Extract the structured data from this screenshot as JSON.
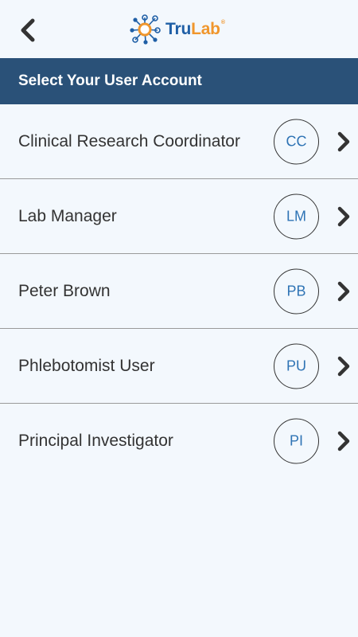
{
  "app": {
    "logo": {
      "text_part1": "Tru",
      "text_part2": "Lab",
      "registered_mark": "®"
    },
    "back_icon": "chevron-left-icon"
  },
  "header": {
    "title": "Select Your User Account"
  },
  "accounts": [
    {
      "name": "Clinical Research Coordinator",
      "initials": "CC"
    },
    {
      "name": "Lab Manager",
      "initials": "LM"
    },
    {
      "name": "Peter Brown",
      "initials": "PB"
    },
    {
      "name": "Phlebotomist User",
      "initials": "PU"
    },
    {
      "name": "Principal Investigator",
      "initials": "PI"
    }
  ],
  "colors": {
    "background": "#f3f8fd",
    "header_bar": "#2a5178",
    "brand_blue": "#1f5fa6",
    "brand_orange": "#f0962c",
    "initials_text": "#2f74b5"
  }
}
